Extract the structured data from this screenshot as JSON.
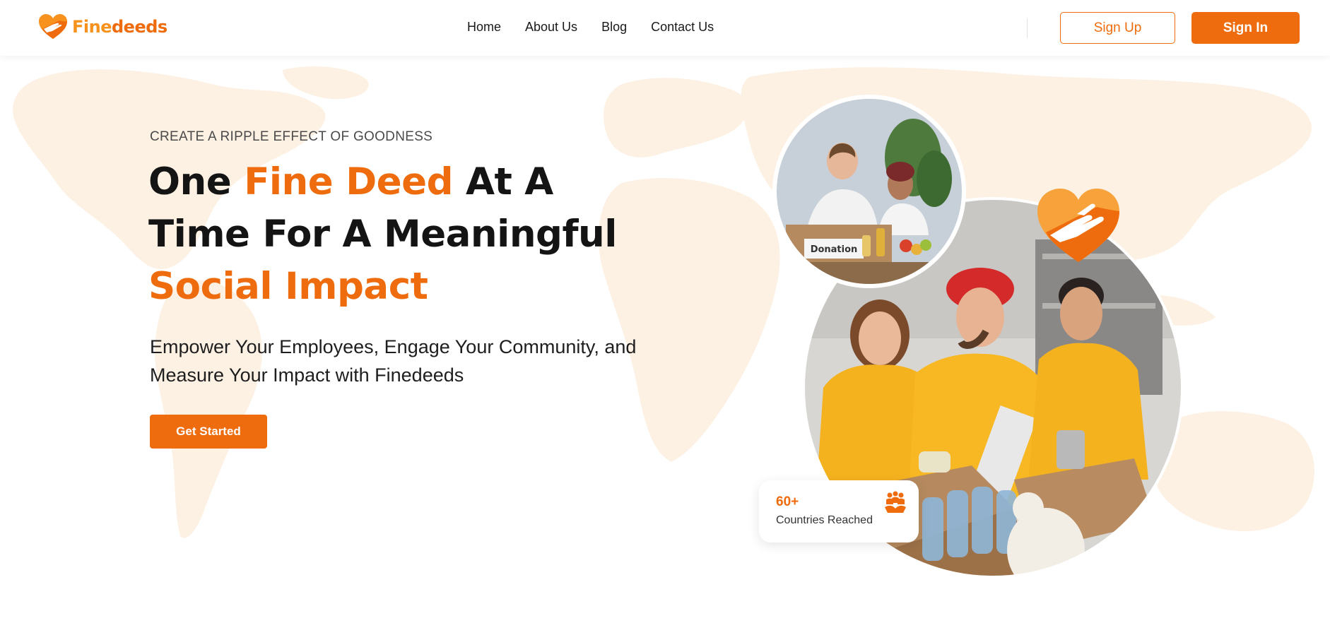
{
  "brand": {
    "name_part1": "Fine",
    "name_part2": "deeds",
    "logo_icon": "heart-hand-icon",
    "accent_color": "#ee6c0d",
    "secondary_color": "#f7921e"
  },
  "nav": {
    "items": [
      {
        "label": "Home"
      },
      {
        "label": "About Us"
      },
      {
        "label": "Blog"
      },
      {
        "label": "Contact Us"
      }
    ]
  },
  "auth": {
    "signup_label": "Sign Up",
    "signin_label": "Sign In"
  },
  "hero": {
    "eyebrow": "CREATE A RIPPLE EFFECT OF GOODNESS",
    "headline_part1": "One ",
    "headline_accent1": "Fine Deed",
    "headline_part2": " At A Time For A Meaningful ",
    "headline_accent2": "Social Impact",
    "subtext": "Empower Your Employees, Engage Your Community, and Measure Your Impact with Finedeeds",
    "cta_label": "Get Started",
    "small_photo_text": "Donation"
  },
  "stat": {
    "value": "60+",
    "label": "Countries Reached",
    "icon": "people-hands-icon"
  }
}
